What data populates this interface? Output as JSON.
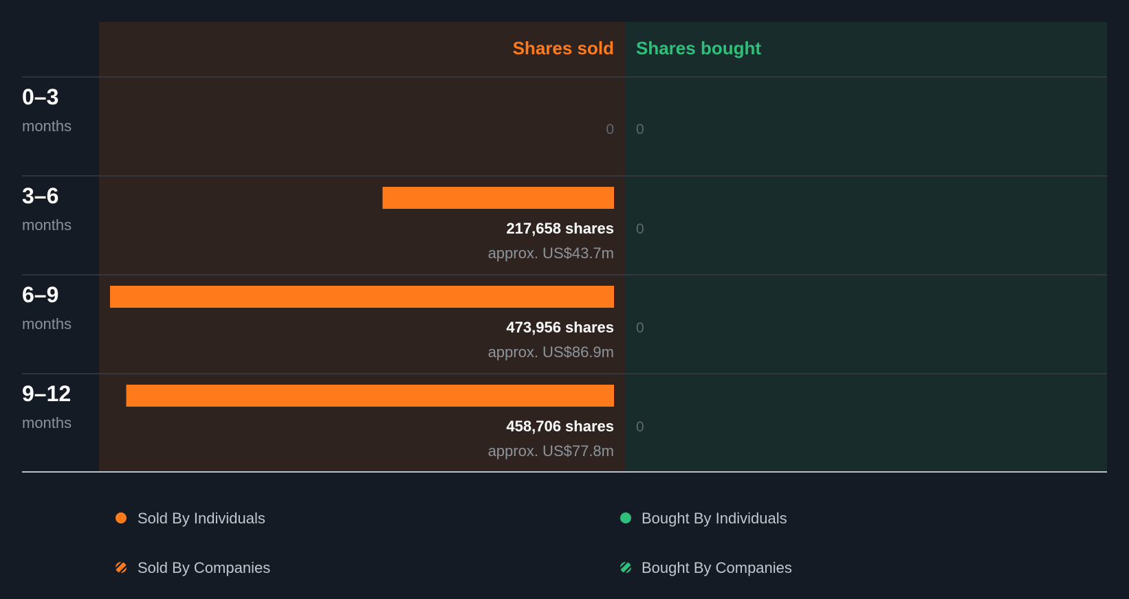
{
  "chart_data": {
    "type": "bar",
    "headers": {
      "sold": "Shares sold",
      "bought": "Shares bought"
    },
    "unit_label": "months",
    "categories": [
      "0–3",
      "3–6",
      "6–9",
      "9–12"
    ],
    "series": [
      {
        "name": "Shares sold",
        "values": [
          0,
          217658,
          473956,
          458706
        ]
      },
      {
        "name": "Shares bought",
        "values": [
          0,
          0,
          0,
          0
        ]
      }
    ],
    "sold_labels": [
      {
        "shares": "0",
        "approx": ""
      },
      {
        "shares": "217,658 shares",
        "approx": "approx. US$43.7m"
      },
      {
        "shares": "473,956 shares",
        "approx": "approx. US$86.9m"
      },
      {
        "shares": "458,706 shares",
        "approx": "approx. US$77.8m"
      }
    ],
    "bought_labels": [
      "0",
      "0",
      "0",
      "0"
    ],
    "xlim": [
      0,
      473956
    ],
    "legend": [
      {
        "label": "Sold By Individuals",
        "color": "#ff7a1a",
        "marker": "dot"
      },
      {
        "label": "Bought By Individuals",
        "color": "#2ec07a",
        "marker": "dot"
      },
      {
        "label": "Sold By Companies",
        "color": "#ff7a1a",
        "marker": "hatch"
      },
      {
        "label": "Bought By Companies",
        "color": "#2ec07a",
        "marker": "hatch"
      }
    ],
    "colors": {
      "sold": "#ff7a1a",
      "bought": "#2ec07a",
      "sold_bg": "#2f2320",
      "bought_bg": "#182c2c",
      "page_bg": "#151b24"
    }
  }
}
